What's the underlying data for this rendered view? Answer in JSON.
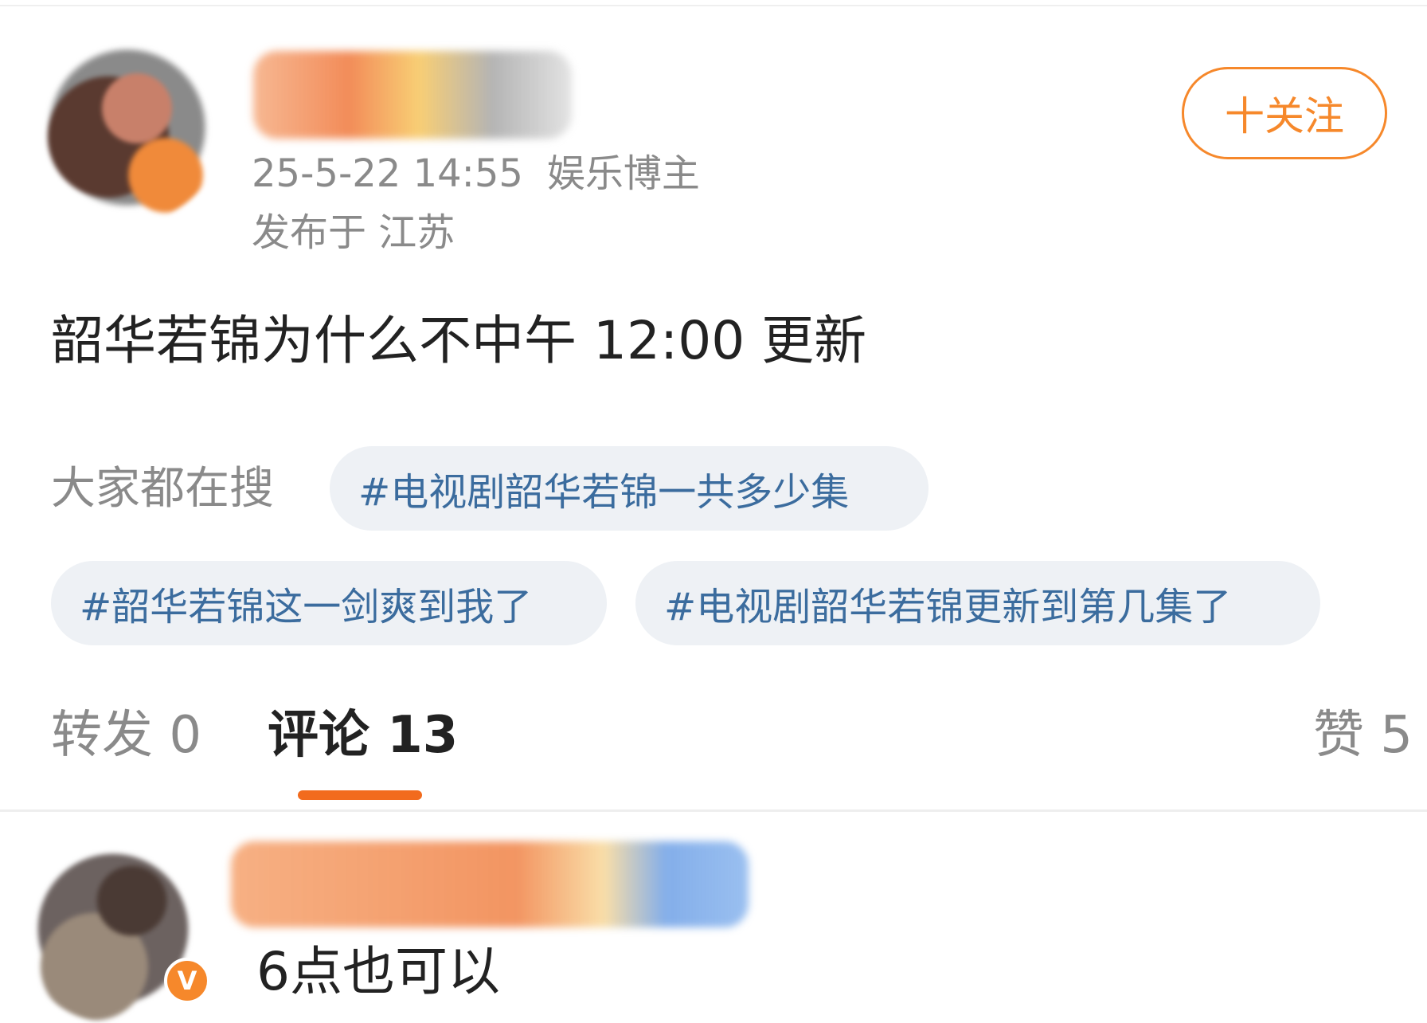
{
  "post": {
    "time": "25-5-22 14:55",
    "author_tag": "娱乐博主",
    "location": "发布于 江苏",
    "follow_label": "十关注",
    "text": "韶华若锦为什么不中午 12:00 更新"
  },
  "hot_search": {
    "label": "大家都在搜",
    "tags": [
      "#电视剧韶华若锦一共多少集",
      "#韶华若锦这一剑爽到我了",
      "#电视剧韶华若锦更新到第几集了"
    ]
  },
  "actions": {
    "repost": "转发 0",
    "comment": "评论 13",
    "like": "赞 5"
  },
  "comment": {
    "badge": "V",
    "text": "6点也可以"
  },
  "colors": {
    "accent": "#f6882b",
    "tab_underline": "#f26b1d",
    "tag_text": "#3b6c9e",
    "tag_bg": "#eef1f5",
    "muted_text": "#8a8a8a"
  }
}
